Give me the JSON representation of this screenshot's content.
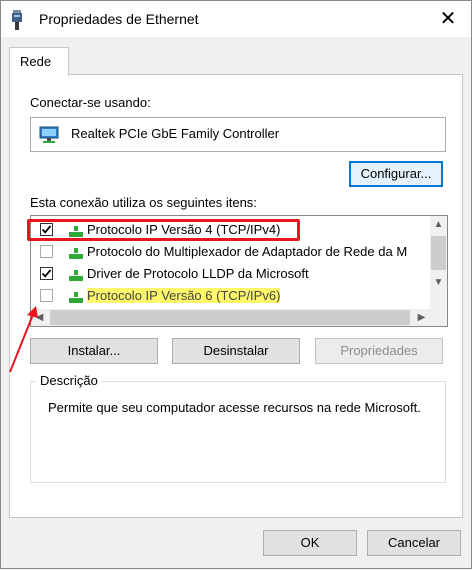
{
  "window": {
    "title": "Propriedades de Ethernet"
  },
  "tabs": [
    {
      "label": "Rede"
    }
  ],
  "connect": {
    "label": "Conectar-se usando:",
    "adapter_name": "Realtek PCIe GbE Family Controller",
    "configure_label": "Configurar..."
  },
  "items_label": "Esta conexão utiliza os seguintes itens:",
  "items": [
    {
      "label": "Protocolo IP Versão 4 (TCP/IPv4)",
      "checked": true
    },
    {
      "label": "Protocolo do Multiplexador de Adaptador de Rede da M",
      "checked": false
    },
    {
      "label": "Driver de Protocolo LLDP da Microsoft",
      "checked": true
    },
    {
      "label": "Protocolo IP Versão 6 (TCP/IPv6)",
      "checked": false
    }
  ],
  "buttons": {
    "install": "Instalar...",
    "uninstall": "Desinstalar",
    "properties": "Propriedades",
    "ok": "OK",
    "cancel": "Cancelar"
  },
  "description": {
    "title": "Descrição",
    "text": "Permite que seu computador acesse recursos na rede Microsoft."
  },
  "colors": {
    "annotation": "#e8161e",
    "highlight": "#fff86a",
    "focus": "#0078d7"
  }
}
